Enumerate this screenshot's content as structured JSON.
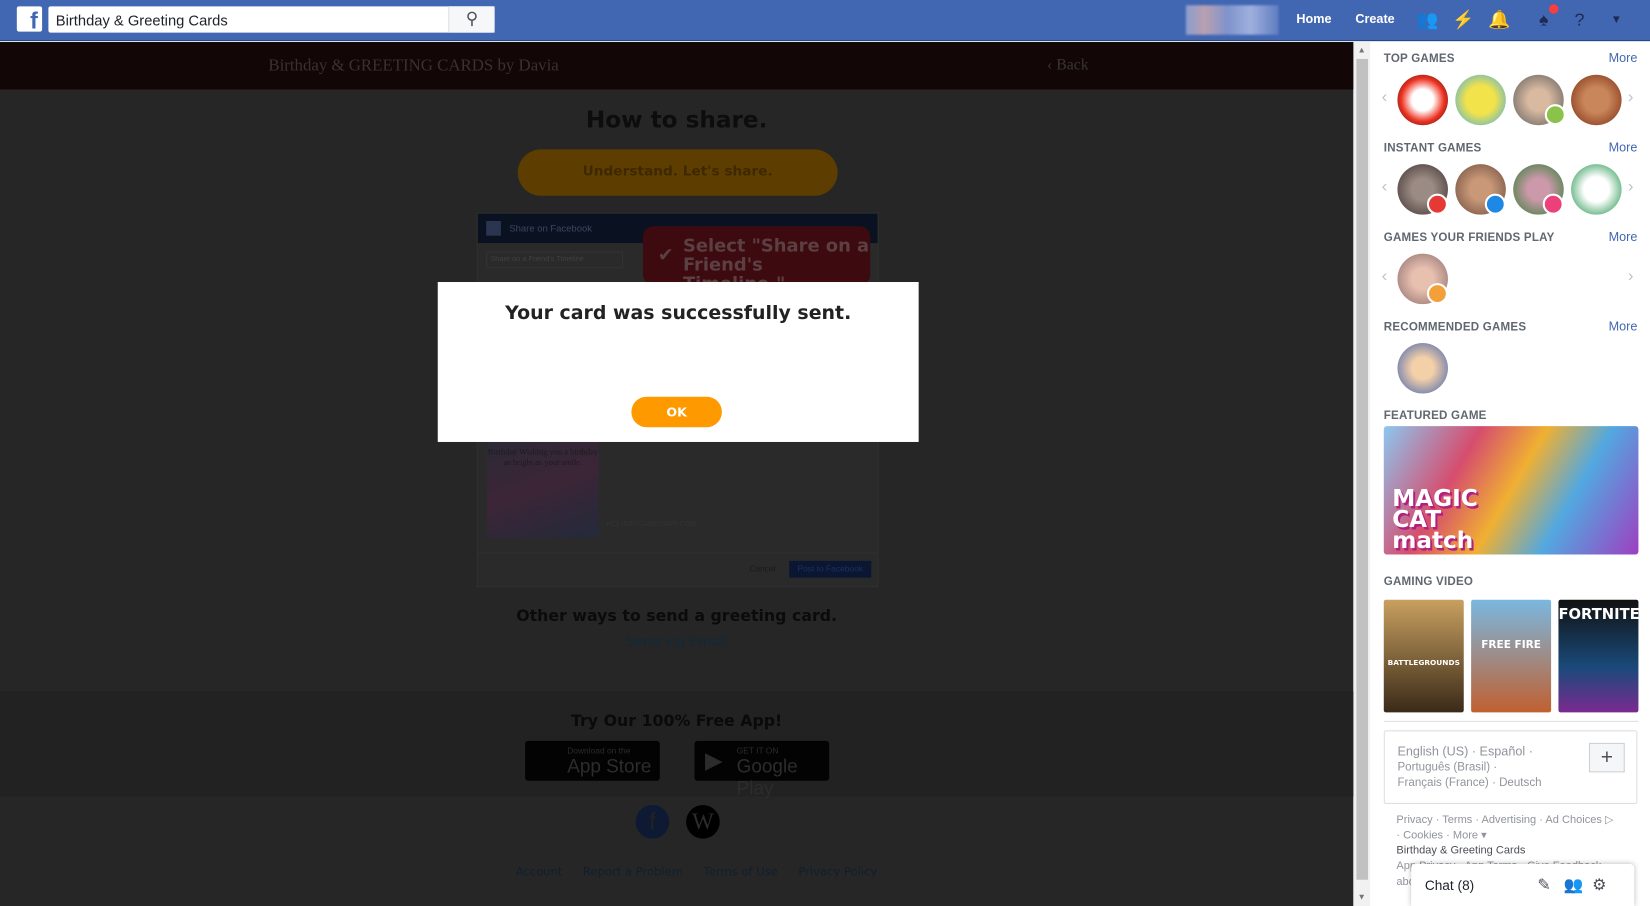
{
  "topbar": {
    "search_value": "Birthday & Greeting Cards",
    "home": "Home",
    "create": "Create",
    "brand_color": "#4267b2"
  },
  "app": {
    "logo_text": "Birthday & GREETING CARDS by Davia",
    "back": "‹ Back",
    "how_to_share": "How to share.",
    "understand_btn": "Understand. Let's share.",
    "mock": {
      "header": "Share on Facebook",
      "select": "Share on a Friend's Timeline",
      "callout": "Select \"Share on a Friend's Timeline.\"",
      "card_text": "Birthday Wishing you a birthday as bright as your smile.",
      "card_url": "HOLIDAYCARDSAPP.COM",
      "cancel": "Cancel",
      "post": "Post to Facebook"
    },
    "other_ways": "Other ways to send a greeting card.",
    "send_email": "Send via Email",
    "try_app": "Try Our 100% Free App!",
    "app_store_small": "Download on the",
    "app_store_big": "App Store",
    "google_small": "GET IT ON",
    "google_big": "Google Play",
    "footer_links": [
      "Account",
      "Report a Problem",
      "Terms of Use",
      "Privacy Policy"
    ]
  },
  "modal": {
    "message": "Your card was successfully sent.",
    "ok": "OK",
    "ok_color": "#ff9900"
  },
  "sidebar": {
    "more": "More",
    "top_games": "TOP GAMES",
    "instant_games": "INSTANT GAMES",
    "friends_play": "GAMES YOUR FRIENDS PLAY",
    "recommended": "RECOMMENDED GAMES",
    "featured": "FEATURED GAME",
    "featured_logo": "MAGIC CAT match",
    "gaming_video": "GAMING VIDEO",
    "videos": [
      "BATTLEGROUNDS",
      "FREE FIRE",
      "FORTNITE"
    ],
    "languages": [
      "English (US) · Español ·",
      "Português (Brasil) ·",
      "Français (France) · Deutsch"
    ],
    "footer_line1": "Privacy · Terms · Advertising · Ad Choices ▷",
    "footer_line2": "· Cookies · More ▾",
    "footer_app": "Birthday & Greeting Cards",
    "footer_line3": "App Privacy · App Terms · Give Feedback ·",
    "footer_line4": "abo",
    "chat": "Chat (8)"
  }
}
